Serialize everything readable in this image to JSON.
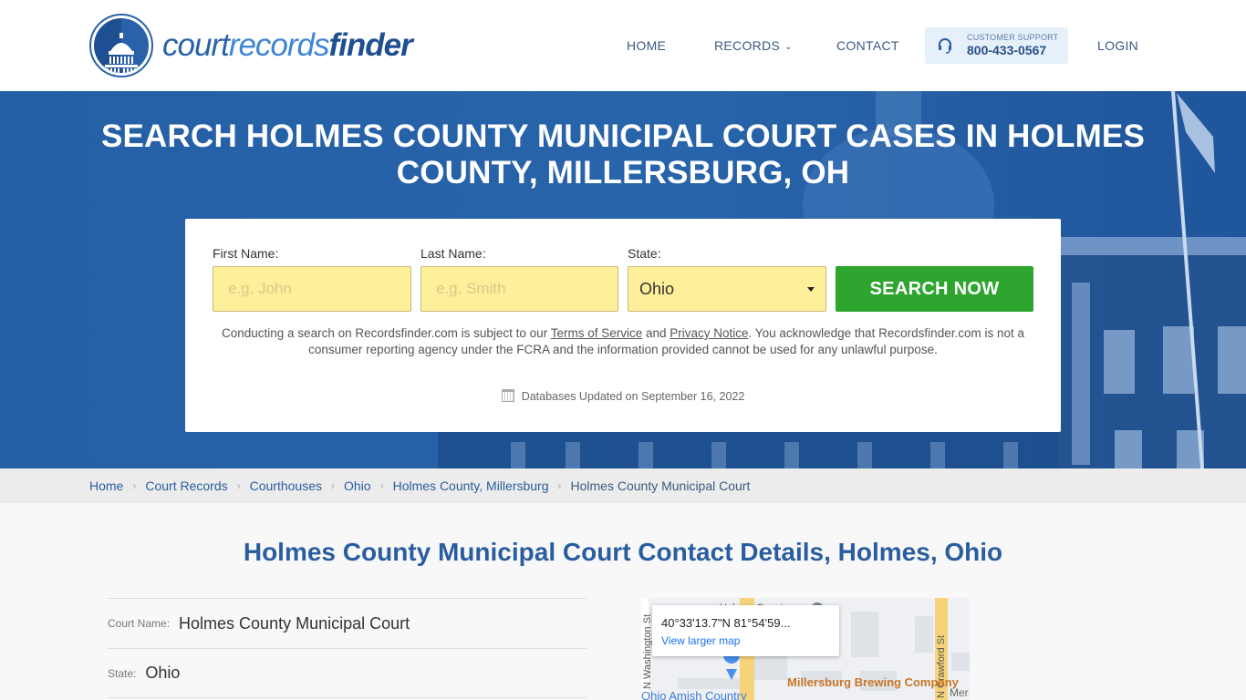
{
  "header": {
    "logo": {
      "part1": "court",
      "part2": "records",
      "part3": "finder"
    },
    "nav": {
      "home": "HOME",
      "records": "RECORDS",
      "contact": "CONTACT",
      "login": "LOGIN"
    },
    "support": {
      "label": "CUSTOMER SUPPORT",
      "phone": "800-433-0567",
      "icon": "headset-icon"
    }
  },
  "hero": {
    "title": "SEARCH HOLMES COUNTY MUNICIPAL COURT CASES IN HOLMES COUNTY, MILLERSBURG, OH",
    "form": {
      "first_name_label": "First Name:",
      "first_name_placeholder": "e.g. John",
      "last_name_label": "Last Name:",
      "last_name_placeholder": "e.g. Smith",
      "state_label": "State:",
      "state_value": "Ohio",
      "search_button": "SEARCH NOW"
    },
    "disclaimer": {
      "part1": "Conducting a search on Recordsfinder.com is subject to our ",
      "terms": "Terms of Service",
      "part2": " and ",
      "privacy": "Privacy Notice",
      "part3": ". You acknowledge that Recordsfinder.com is not a consumer reporting agency under the FCRA and the information provided cannot be used for any unlawful purpose."
    },
    "db_updated": "Databases Updated on September 16, 2022"
  },
  "breadcrumb": [
    "Home",
    "Court Records",
    "Courthouses",
    "Ohio",
    "Holmes County, Millersburg",
    "Holmes County Municipal Court"
  ],
  "main": {
    "title": "Holmes County Municipal Court Contact Details, Holmes, Ohio",
    "details": [
      {
        "label": "Court Name:",
        "value": "Holmes County Municipal Court"
      },
      {
        "label": "State:",
        "value": "Ohio"
      }
    ],
    "map": {
      "coords": "40°33'13.7\"N 81°54'59...",
      "link": "View larger map",
      "labels": {
        "street1": "N Washington St",
        "street2": "N Crawford St",
        "poi1": "Millersburg Brewing Company",
        "poi2": "Ohio Amish Country",
        "poi3": "Holmes County",
        "poi4": "Mer"
      }
    }
  },
  "colors": {
    "brand_blue": "#2a62a9",
    "hero_blue": "#2560a6",
    "search_green": "#2ea52e",
    "input_yellow": "#feef9b"
  }
}
